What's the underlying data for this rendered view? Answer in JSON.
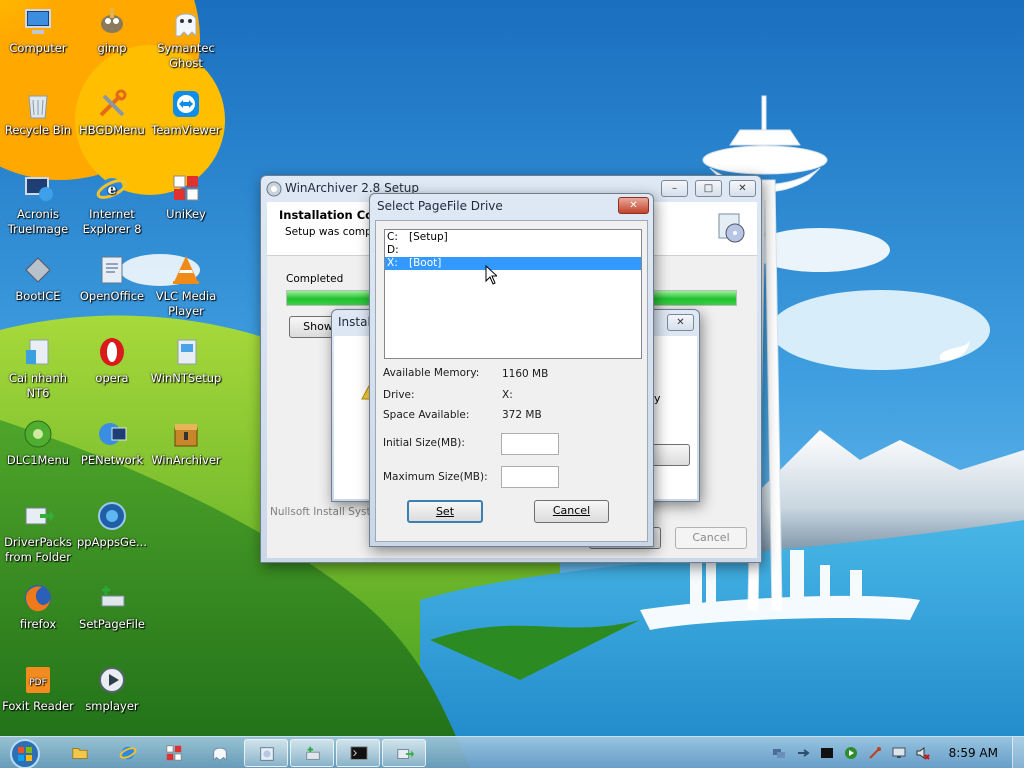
{
  "desktop_icons": [
    {
      "label": "Computer",
      "icon": "computer-icon"
    },
    {
      "label": "gimp",
      "icon": "gimp-icon"
    },
    {
      "label": "Symantec Ghost",
      "icon": "ghost-icon"
    },
    {
      "label": "Recycle Bin",
      "icon": "recycle-bin-icon"
    },
    {
      "label": "HBGDMenu",
      "icon": "tools-icon"
    },
    {
      "label": "TeamViewer",
      "icon": "teamviewer-icon"
    },
    {
      "label": "Acronis TrueImage",
      "icon": "acronis-icon"
    },
    {
      "label": "Internet Explorer 8",
      "icon": "internet-explorer-icon"
    },
    {
      "label": "UniKey",
      "icon": "unikey-icon"
    },
    {
      "label": "BootICE",
      "icon": "bootice-icon"
    },
    {
      "label": "OpenOffice",
      "icon": "openoffice-icon"
    },
    {
      "label": "VLC Media Player",
      "icon": "vlc-icon"
    },
    {
      "label": "Cai nhanh NT6",
      "icon": "installer-icon"
    },
    {
      "label": "opera",
      "icon": "opera-icon"
    },
    {
      "label": "WinNTSetup",
      "icon": "winntsetup-icon"
    },
    {
      "label": "DLC1Menu",
      "icon": "dlc-icon"
    },
    {
      "label": "PENetwork",
      "icon": "network-icon"
    },
    {
      "label": "WinArchiver",
      "icon": "winarchiver-icon"
    },
    {
      "label": "DriverPacks from Folder",
      "icon": "driverpacks-icon"
    },
    {
      "label": "ppAppsGe...",
      "icon": "ppapps-icon"
    },
    {
      "label": "firefox",
      "icon": "firefox-icon"
    },
    {
      "label": "SetPageFile",
      "icon": "setpagefile-icon"
    },
    {
      "label": "Foxit Reader",
      "icon": "foxit-reader-icon"
    },
    {
      "label": "smplayer",
      "icon": "smplayer-icon"
    }
  ],
  "installer_window": {
    "title": "WinArchiver 2.8 Setup",
    "header_title": "Installation Comp",
    "header_subtitle": "Setup was comple",
    "status_label": "Completed",
    "progress_fraction": 1.0,
    "show_button": "Show",
    "brand_text": "Nullsoft Install Syste",
    "cancel_button": "Cancel"
  },
  "inner_dialog": {
    "title": "Install",
    "partial_text": "y"
  },
  "pagefile_dialog": {
    "title": "Select PageFile Drive",
    "drives": [
      {
        "letter": "C:",
        "label": "[Setup]",
        "selected": false
      },
      {
        "letter": "D:",
        "label": "",
        "selected": false
      },
      {
        "letter": "X:",
        "label": "[Boot]",
        "selected": true
      }
    ],
    "available_memory_label": "Available Memory:",
    "available_memory_value": "1160 MB",
    "drive_label": "Drive:",
    "drive_value": "X:",
    "space_available_label": "Space Available:",
    "space_available_value": "372 MB",
    "initial_size_label": "Initial Size(MB):",
    "initial_size_value": "",
    "maximum_size_label": "Maximum Size(MB):",
    "maximum_size_value": "",
    "set_button": "Set",
    "cancel_button": "Cancel"
  },
  "taskbar": {
    "clock": "8:59 AM"
  },
  "colors": {
    "selection": "#3399ff",
    "progress": "#21c12f",
    "sun": "#ffc400"
  }
}
